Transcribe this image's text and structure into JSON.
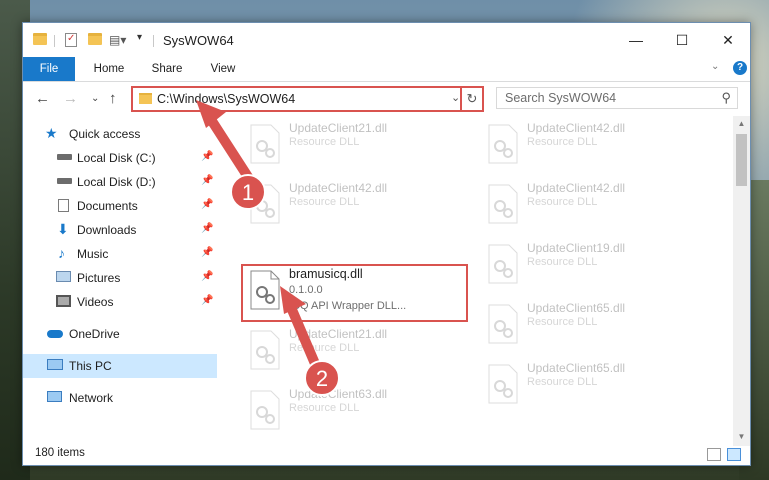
{
  "window": {
    "title": "SysWOW64"
  },
  "ribbon": {
    "tabs": [
      "File",
      "Home",
      "Share",
      "View"
    ]
  },
  "address": {
    "path": "C:\\Windows\\SysWOW64"
  },
  "search": {
    "placeholder": "Search SysWOW64"
  },
  "nav": {
    "quick_access": "Quick access",
    "items": [
      {
        "label": "Local Disk (C:)",
        "icon": "drive-icon"
      },
      {
        "label": "Local Disk (D:)",
        "icon": "drive-icon"
      },
      {
        "label": "Documents",
        "icon": "documents-icon"
      },
      {
        "label": "Downloads",
        "icon": "download-icon"
      },
      {
        "label": "Music",
        "icon": "music-icon"
      },
      {
        "label": "Pictures",
        "icon": "pictures-icon"
      },
      {
        "label": "Videos",
        "icon": "videos-icon"
      }
    ],
    "onedrive": "OneDrive",
    "this_pc": "This PC",
    "network": "Network"
  },
  "files": {
    "left": [
      {
        "name": "UpdateClient21.dll",
        "sub": "Resource DLL"
      },
      {
        "name": "UpdateClient42.dll",
        "sub": "Resource DLL"
      },
      {
        "name": "bramusicq.dll",
        "sub": "0.1.0.0",
        "sub2": "ICQ API Wrapper DLL..."
      },
      {
        "name": "UpdateClient21.dll",
        "sub": "Resource DLL"
      },
      {
        "name": "UpdateClient63.dll",
        "sub": "Resource DLL"
      }
    ],
    "right": [
      {
        "name": "UpdateClient42.dll",
        "sub": "Resource DLL"
      },
      {
        "name": "UpdateClient42.dll",
        "sub": "Resource DLL"
      },
      {
        "name": "UpdateClient19.dll",
        "sub": "Resource DLL"
      },
      {
        "name": "UpdateClient65.dll",
        "sub": "Resource DLL"
      },
      {
        "name": "UpdateClient65.dll",
        "sub": "Resource DLL"
      }
    ]
  },
  "status": {
    "items_count": "180 items"
  },
  "annotations": {
    "step1": "1",
    "step2": "2"
  },
  "colors": {
    "accent": "#1979ca",
    "highlight": "#d9534f"
  }
}
